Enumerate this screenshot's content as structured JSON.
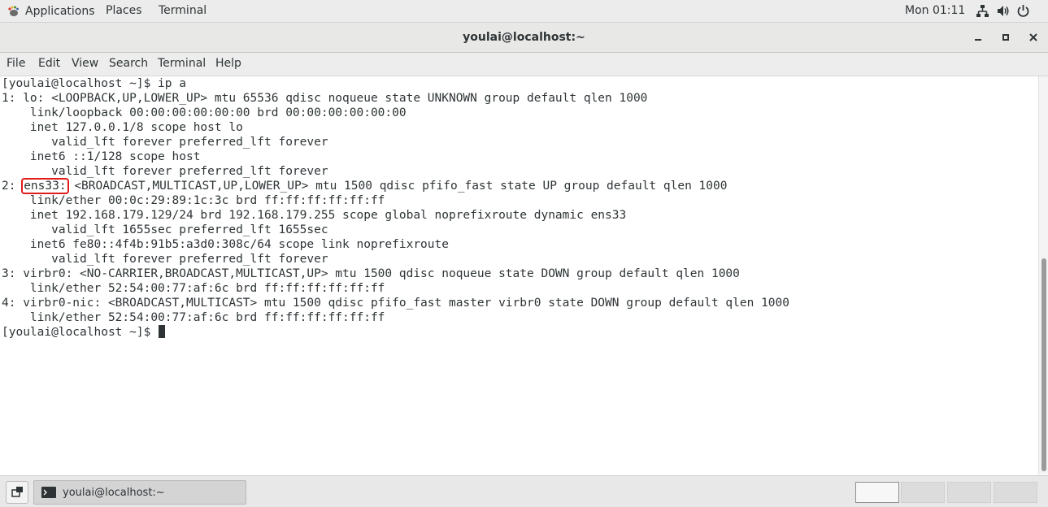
{
  "topbar": {
    "applications_label": "Applications",
    "places_label": "Places",
    "terminal_label": "Terminal",
    "clock": "Mon 01:11",
    "tray_icons": [
      "network-icon",
      "volume-icon",
      "power-icon"
    ]
  },
  "window": {
    "title": "youlai@localhost:~",
    "buttons": [
      "minimize-icon",
      "maximize-icon",
      "close-icon"
    ]
  },
  "menubar": {
    "file": "File",
    "edit": "Edit",
    "view": "View",
    "search": "Search",
    "terminal": "Terminal",
    "help": "Help"
  },
  "terminal": {
    "lines": [
      "[youlai@localhost ~]$ ip a",
      "1: lo: <LOOPBACK,UP,LOWER_UP> mtu 65536 qdisc noqueue state UNKNOWN group default qlen 1000",
      "    link/loopback 00:00:00:00:00:00 brd 00:00:00:00:00:00",
      "    inet 127.0.0.1/8 scope host lo",
      "       valid_lft forever preferred_lft forever",
      "    inet6 ::1/128 scope host",
      "       valid_lft forever preferred_lft forever",
      "    link/ether 00:0c:29:89:1c:3c brd ff:ff:ff:ff:ff:ff",
      "    inet 192.168.179.129/24 brd 192.168.179.255 scope global noprefixroute dynamic ens33",
      "       valid_lft 1655sec preferred_lft 1655sec",
      "    inet6 fe80::4f4b:91b5:a3d0:308c/64 scope link noprefixroute",
      "       valid_lft forever preferred_lft forever",
      "3: virbr0: <NO-CARRIER,BROADCAST,MULTICAST,UP> mtu 1500 qdisc noqueue state DOWN group default qlen 1000",
      "    link/ether 52:54:00:77:af:6c brd ff:ff:ff:ff:ff:ff",
      "4: virbr0-nic: <BROADCAST,MULTICAST> mtu 1500 qdisc pfifo_fast master virbr0 state DOWN group default qlen 1000",
      "    link/ether 52:54:00:77:af:6c brd ff:ff:ff:ff:ff:ff"
    ],
    "ens33_line": {
      "prefix": "2: ",
      "highlighted": "ens33:",
      "rest": " <BROADCAST,MULTICAST,UP,LOWER_UP> mtu 1500 qdisc pfifo_fast state UP group default qlen 1000"
    },
    "prompt": "[youlai@localhost ~]$ ",
    "highlight_color": "#e01b1b"
  },
  "taskbar": {
    "window_label": "youlai@localhost:~",
    "workspaces": [
      "1",
      "2",
      "3",
      "4"
    ]
  }
}
